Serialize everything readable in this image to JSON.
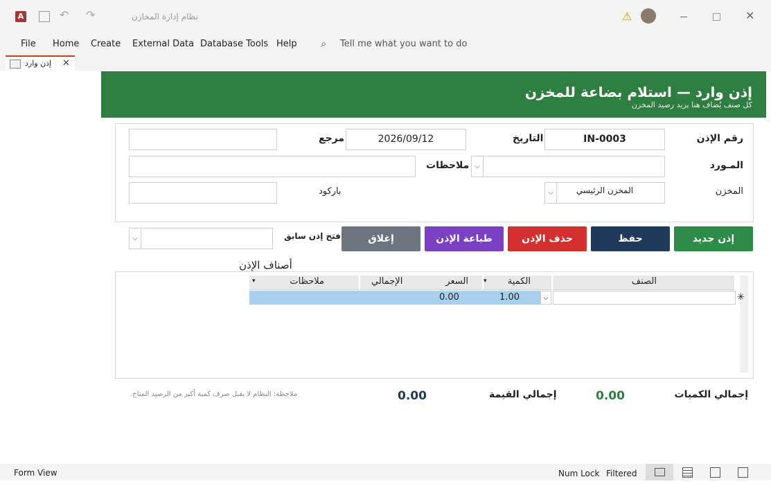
{
  "window": {
    "title": "نظام إدارة المخازن"
  },
  "menu": {
    "items": [
      "File",
      "Home",
      "Create",
      "External Data",
      "Database Tools",
      "Help"
    ],
    "search_placeholder": "Tell me what you want to do"
  },
  "doc_tab": {
    "label": "إذن وارد"
  },
  "header": {
    "title": "إذن وارد — استلام بضاعة للمخزن",
    "subtitle": "كل صنف يُضاف هنا يزيد رصيد المخزن"
  },
  "form": {
    "permit_no_label": "رقم الإذن",
    "permit_no": "IN-0003",
    "date_label": "التاريخ",
    "date": "2026/09/12",
    "ref_label": "مرجع",
    "ref": "",
    "supplier_label": "المـورد",
    "supplier": "",
    "notes_label": "ملاحظات",
    "notes": "",
    "warehouse_label": "المخزن",
    "warehouse": "المخزن الرئيسي",
    "barcode_label": "باركود",
    "barcode": ""
  },
  "buttons": {
    "new": "إذن جديد",
    "save": "حفظ",
    "delete": "حذف الإذن",
    "print": "طباعة الإذن",
    "close": "إغلاق",
    "open_prev_label": "فتح إذن سابق"
  },
  "items": {
    "title": "أصناف الإذن",
    "columns": [
      "الصنف",
      "الكمية",
      "السعر",
      "الإجمالي",
      "ملاحظات"
    ],
    "new_row": {
      "item": "",
      "qty": "1.00",
      "price": "0.00",
      "total": "",
      "notes": ""
    }
  },
  "totals": {
    "qty_label": "إجمالي الكميات",
    "qty": "0.00",
    "value_label": "إجمالي القيمة",
    "value": "0.00",
    "note": "ملاحظة: النظام لا يقبل صرف كمية أكبر من الرصيد المتاح."
  },
  "status": {
    "view": "Form View",
    "numlock": "Num Lock",
    "filtered": "Filtered"
  },
  "colors": {
    "header": "#2e7d41",
    "new": "#2e8b47",
    "save": "#1f3a5a",
    "delete": "#d32f2f",
    "print": "#7b3fc4",
    "close": "#6d747d"
  }
}
